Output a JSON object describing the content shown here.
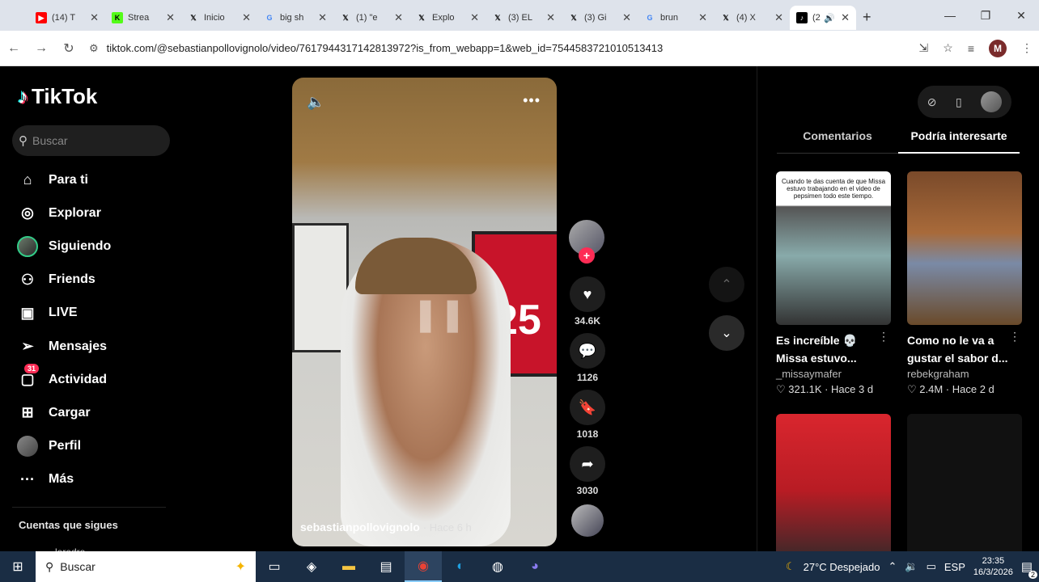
{
  "browser": {
    "tabs": [
      {
        "label": "(14) T",
        "icon": "youtube-icon",
        "color": "#ff0000"
      },
      {
        "label": "Strea",
        "icon": "kick-icon",
        "color": "#53fc18"
      },
      {
        "label": "Inicio",
        "icon": "x-icon",
        "color": "#000000"
      },
      {
        "label": "big sh",
        "icon": "google-icon",
        "color": "#4285f4"
      },
      {
        "label": "(1) \"e",
        "icon": "x-icon",
        "color": "#000000"
      },
      {
        "label": "Explo",
        "icon": "x-icon",
        "color": "#000000"
      },
      {
        "label": "(3) EL",
        "icon": "x-icon",
        "color": "#000000"
      },
      {
        "label": "(3) Gi",
        "icon": "x-icon",
        "color": "#000000"
      },
      {
        "label": "brun",
        "icon": "google-icon",
        "color": "#4285f4"
      },
      {
        "label": "(4) X",
        "icon": "x-icon",
        "color": "#000000"
      },
      {
        "label": "(2",
        "icon": "tiktok-icon",
        "color": "#000000",
        "active": true
      }
    ],
    "url": "tiktok.com/@sebastianpollovignolo/video/7617944317142813972?is_from_webapp=1&web_id=7544583721010513413",
    "profile_initial": "M"
  },
  "sidebar": {
    "brand": "TikTok",
    "search_placeholder": "Buscar",
    "items": [
      {
        "label": "Para ti",
        "icon": "home-icon"
      },
      {
        "label": "Explorar",
        "icon": "compass-icon"
      },
      {
        "label": "Siguiendo",
        "icon": "following-avatar"
      },
      {
        "label": "Friends",
        "icon": "friends-icon"
      },
      {
        "label": "LIVE",
        "icon": "live-icon"
      },
      {
        "label": "Mensajes",
        "icon": "messages-icon"
      },
      {
        "label": "Actividad",
        "icon": "activity-icon",
        "badge": "31"
      },
      {
        "label": "Cargar",
        "icon": "upload-icon"
      },
      {
        "label": "Perfil",
        "icon": "profile-avatar"
      },
      {
        "label": "Más",
        "icon": "more-icon"
      }
    ],
    "following_header": "Cuentas que sigues",
    "partial_account": "leredro"
  },
  "video": {
    "author": "sebastianpollovignolo",
    "ago": "· Hace 6 h",
    "jersey_text": "25"
  },
  "actions": {
    "likes": "34.6K",
    "comments": "1126",
    "saves": "1018",
    "shares": "3030"
  },
  "rightpanel": {
    "tabs": [
      "Comentarios",
      "Podría interesarte"
    ],
    "active_tab": 1,
    "cards": [
      {
        "title": "Es increíble 💀 Missa estuvo...",
        "user": "_missaymafer",
        "likes": "321.1K",
        "ago": "Hace 3 d",
        "thumb_text": "Cuando te das cuenta de que Missa estuvo trabajando en el video de pepsimen todo este tiempo."
      },
      {
        "title": "Como no le va a gustar el sabor d...",
        "user": "rebekgraham",
        "likes": "2.4M",
        "ago": "Hace 2 d",
        "thumb_text": ""
      },
      {
        "title": "",
        "user": "",
        "likes": "",
        "ago": "",
        "thumb_text": ""
      },
      {
        "title": "",
        "user": "",
        "likes": "",
        "ago": "",
        "thumb_text": ""
      }
    ]
  },
  "taskbar": {
    "search": "Buscar",
    "weather": "27°C  Despejado",
    "lang": "ESP",
    "time": "23:35",
    "date": "16/3/2026",
    "notifications": "2"
  }
}
